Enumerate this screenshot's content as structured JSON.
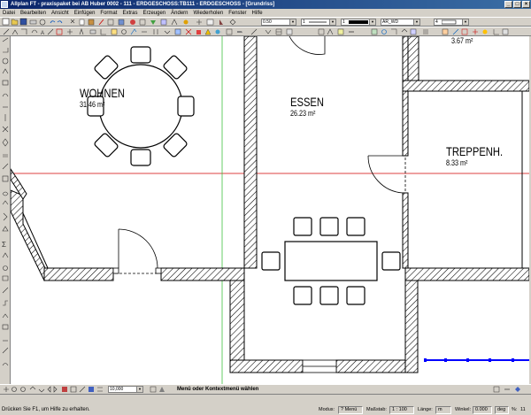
{
  "window": {
    "title": "Allplan FT - praxispaket bei AB Huber 0002 - 111 - ERDGESCHOSS:TB111 - ERDGESCHOSS - [Grundriss]"
  },
  "menu": [
    "Datei",
    "Bearbeiten",
    "Ansicht",
    "Einfügen",
    "Format",
    "Extras",
    "Erzeugen",
    "Ändern",
    "Wiederholen",
    "Fenster",
    "Hilfe"
  ],
  "toolbar": {
    "pen": "0.50",
    "line": "1",
    "color": "1",
    "layer": "AR_WD",
    "pattern": "4"
  },
  "drawing": {
    "rooms": [
      {
        "name": "WOHNEN",
        "area": "31.46 m²"
      },
      {
        "name": "ESSEN",
        "area": "26.23 m²"
      },
      {
        "name": "TREPPENH.",
        "area": "8.33 m²"
      },
      {
        "name": "",
        "area": "3.67 m²"
      }
    ]
  },
  "bottom": {
    "scale_value": "10,000",
    "context_hint": "Menü oder Kontextmenü wählen"
  },
  "status": {
    "help": "Drücken Sie F1, um Hilfe zu erhalten.",
    "modus_label": "Modus:",
    "modus_value": "? Menü",
    "massstab_label": "Maßstab:",
    "massstab_value": "1 : 100",
    "laenge_label": "Länge:",
    "laenge_value": "m",
    "winkel_label": "Winkel:",
    "winkel_value": "0.000",
    "unit": "deg",
    "percent_label": "%:",
    "percent_value": "11"
  },
  "colors": {
    "title_start": "#0a246a",
    "title_end": "#3a6ea5",
    "chrome": "#d4d0c8",
    "crosshair_red": "#d00000",
    "crosshair_green": "#40c040",
    "selection_blue": "#0000ff"
  }
}
